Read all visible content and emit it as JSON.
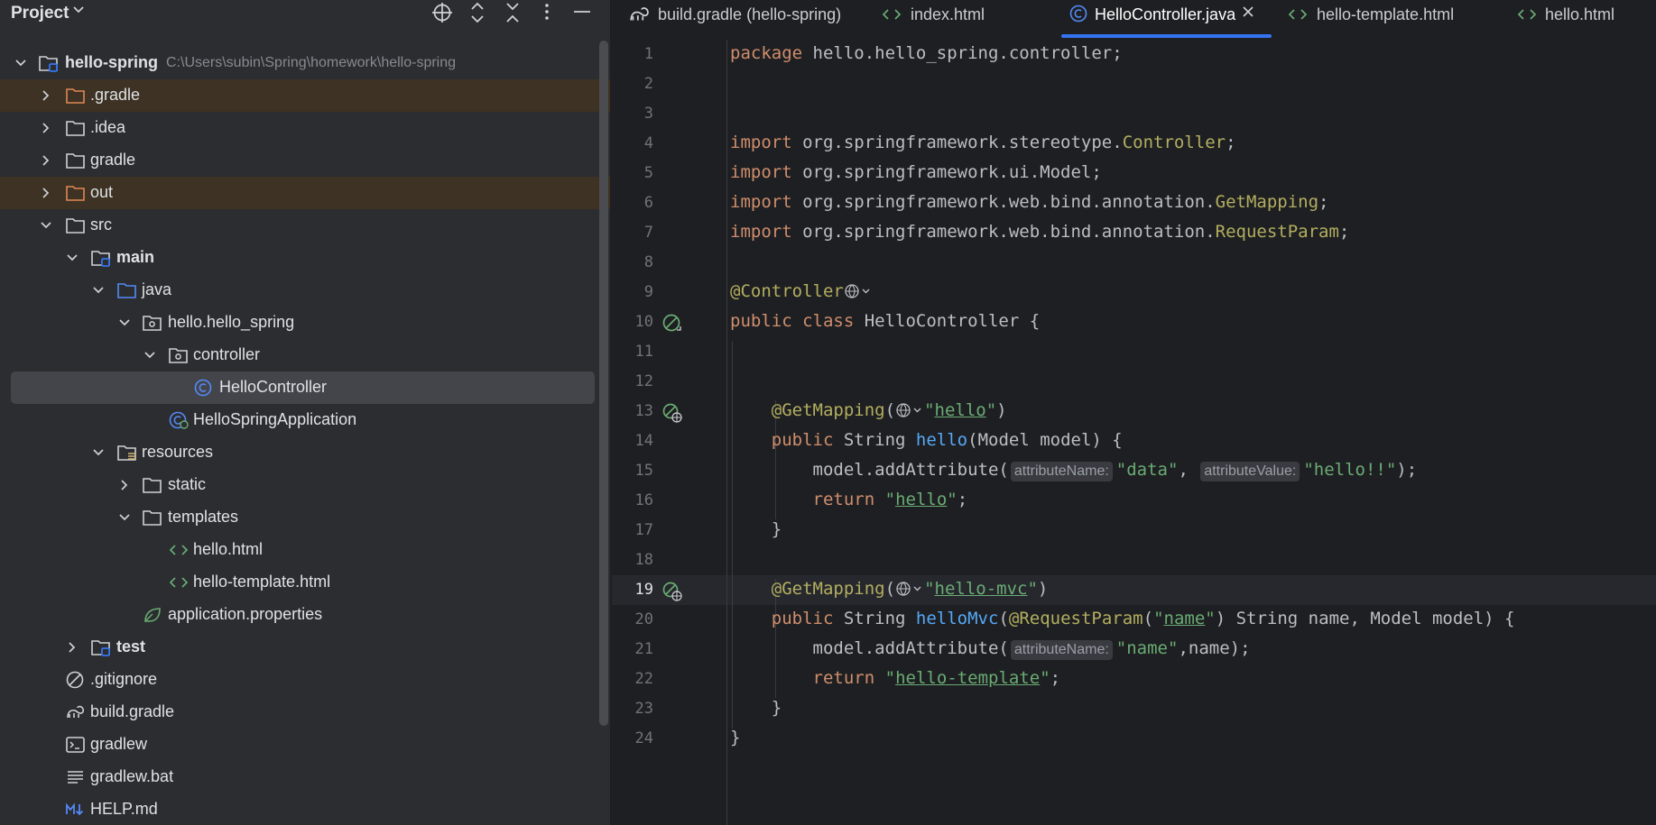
{
  "project_panel": {
    "title": "Project",
    "tree": [
      {
        "label": "hello-spring",
        "path": "C:\\Users\\subin\\Spring\\homework\\hello-spring",
        "bold": true
      },
      {
        "label": ".gradle"
      },
      {
        "label": ".idea"
      },
      {
        "label": "gradle"
      },
      {
        "label": "out"
      },
      {
        "label": "src"
      },
      {
        "label": "main",
        "bold": true
      },
      {
        "label": "java"
      },
      {
        "label": "hello.hello_spring"
      },
      {
        "label": "controller"
      },
      {
        "label": "HelloController"
      },
      {
        "label": "HelloSpringApplication"
      },
      {
        "label": "resources"
      },
      {
        "label": "static"
      },
      {
        "label": "templates"
      },
      {
        "label": "hello.html"
      },
      {
        "label": "hello-template.html"
      },
      {
        "label": "application.properties"
      },
      {
        "label": "test",
        "bold": true
      },
      {
        "label": ".gitignore"
      },
      {
        "label": "build.gradle"
      },
      {
        "label": "gradlew"
      },
      {
        "label": "gradlew.bat"
      },
      {
        "label": "HELP.md"
      }
    ]
  },
  "tabs": [
    {
      "label": "build.gradle (hello-spring)",
      "icon": "gradle-icon"
    },
    {
      "label": "index.html",
      "icon": "html-icon"
    },
    {
      "label": "HelloController.java",
      "icon": "class-icon",
      "active": true
    },
    {
      "label": "hello-template.html",
      "icon": "html-icon"
    },
    {
      "label": "hello.html",
      "icon": "html-icon"
    }
  ],
  "editor": {
    "line_numbers": [
      "1",
      "2",
      "3",
      "4",
      "5",
      "6",
      "7",
      "8",
      "9",
      "10",
      "11",
      "12",
      "13",
      "14",
      "15",
      "16",
      "17",
      "18",
      "19",
      "20",
      "21",
      "22",
      "23",
      "24"
    ],
    "current_line": "19",
    "code": {
      "l1_kw": "package",
      "l1_rest": " hello.hello_spring.controller;",
      "l4_kw": "import",
      "l4_a": " org.springframework.stereotype.",
      "l4_b": "Controller",
      "l4_c": ";",
      "l5_kw": "import",
      "l5_a": " org.springframework.ui.Model;",
      "l6_kw": "import",
      "l6_a": " org.springframework.web.bind.annotation.",
      "l6_b": "GetMapping",
      "l6_c": ";",
      "l7_kw": "import",
      "l7_a": " org.springframework.web.bind.annotation.",
      "l7_b": "RequestParam",
      "l7_c": ";",
      "l9_ann": "@Controller",
      "l10_kw": "public class",
      "l10_a": " HelloController {",
      "l12_ann": "@GetMapping",
      "l12_a": "(",
      "l12_s1": "\"",
      "l12_s2": "hello",
      "l12_s3": "\"",
      "l12_b": ")",
      "l13_kw": "public",
      "l13_a": " String ",
      "l13_fn": "hello",
      "l13_b": "(Model model) {",
      "l14_a": "model.addAttribute(",
      "l14_h1": "attributeName:",
      "l14_s1": "\"data\"",
      "l14_b": ", ",
      "l14_h2": "attributeValue:",
      "l14_s2": "\"hello!!\"",
      "l14_c": ");",
      "l15_kw": "return",
      "l15_a": " ",
      "l15_s1": "\"",
      "l15_s2": "hello",
      "l15_s3": "\"",
      "l15_b": ";",
      "l16_a": "}",
      "l18_ann": "@GetMapping",
      "l18_a": "(",
      "l18_s1": "\"",
      "l18_s2": "hello-mvc",
      "l18_s3": "\"",
      "l18_b": ")",
      "l19_kw": "public",
      "l19_a": " String ",
      "l19_fn": "helloMvc",
      "l19_b": "(",
      "l19_ann": "@RequestParam",
      "l19_c": "(",
      "l19_s1": "\"",
      "l19_s2": "name",
      "l19_s3": "\"",
      "l19_d": ") String name, Model model) {",
      "l20_a": "model.addAttribute(",
      "l20_h1": "attributeName:",
      "l20_s1": "\"name\"",
      "l20_b": ",name);",
      "l21_kw": "return",
      "l21_a": " ",
      "l21_s1": "\"",
      "l21_s2": "hello-template",
      "l21_s3": "\"",
      "l21_b": ";",
      "l22_a": "}",
      "l23_a": "}"
    }
  },
  "colors": {
    "panel_bg": "#2b2d30",
    "editor_bg": "#1e1f22",
    "accent": "#3574f0",
    "keyword": "#cf8e6d",
    "annotation": "#b3ae60",
    "string": "#6aab73",
    "function": "#56a8f5",
    "excluded_folder": "#3d3223"
  }
}
